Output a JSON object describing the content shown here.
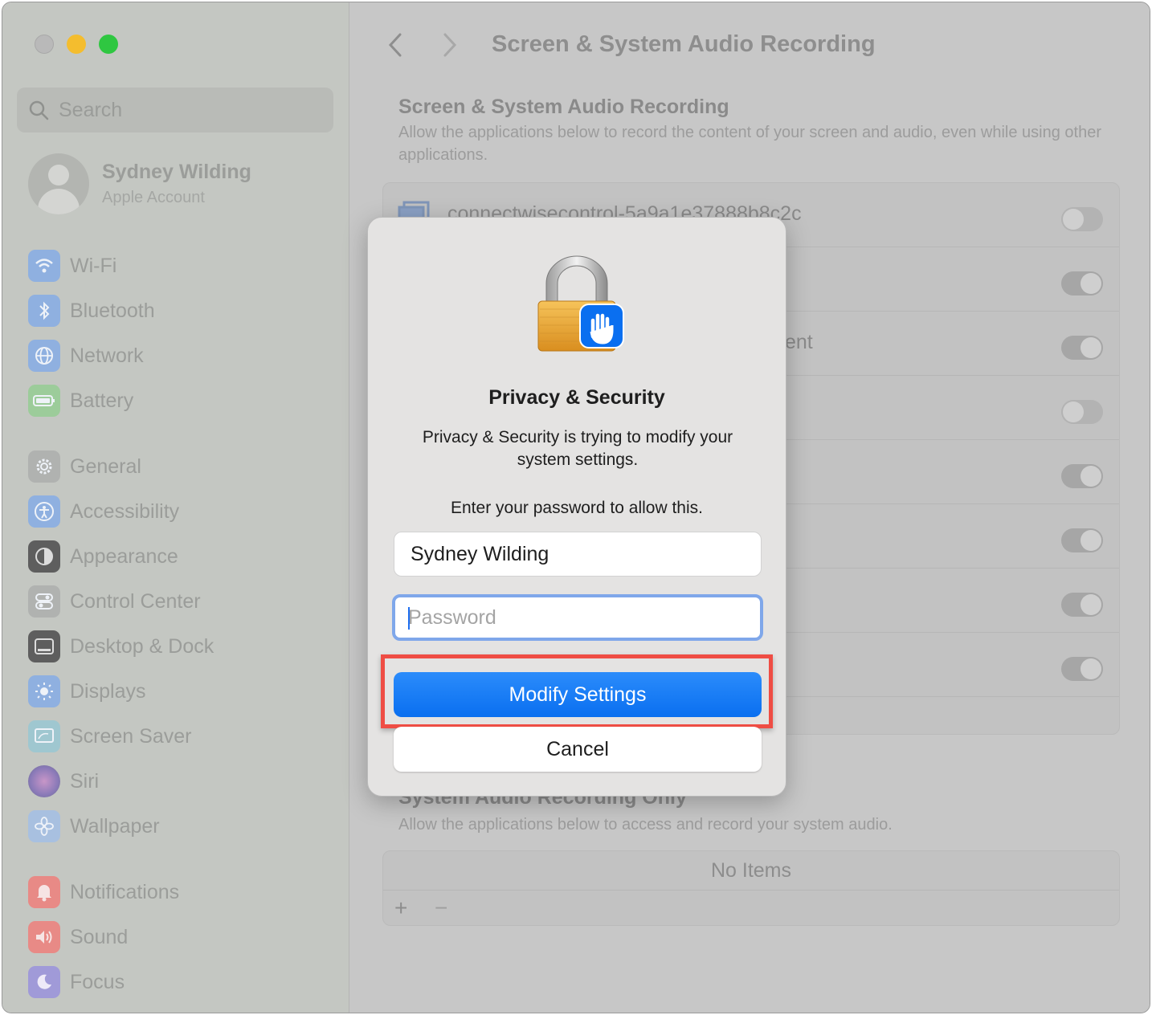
{
  "sidebar": {
    "search_placeholder": "Search",
    "account": {
      "name": "Sydney Wilding",
      "subtitle": "Apple Account"
    },
    "items": [
      {
        "label": "Wi-Fi",
        "icon": "wifi-icon",
        "color": "#8fb0e0"
      },
      {
        "label": "Bluetooth",
        "icon": "bluetooth-icon",
        "color": "#8fb0e0"
      },
      {
        "label": "Network",
        "icon": "globe-icon",
        "color": "#8fb0e0"
      },
      {
        "label": "Battery",
        "icon": "battery-icon",
        "color": "#9ccc9a"
      },
      {
        "label": "General",
        "icon": "gear-icon",
        "color": "#b0b2b0"
      },
      {
        "label": "Accessibility",
        "icon": "accessibility-icon",
        "color": "#8fb0e0"
      },
      {
        "label": "Appearance",
        "icon": "appearance-icon",
        "color": "#5e5e5e"
      },
      {
        "label": "Control Center",
        "icon": "control-center-icon",
        "color": "#b0b2b0"
      },
      {
        "label": "Desktop & Dock",
        "icon": "dock-icon",
        "color": "#5e5e5e"
      },
      {
        "label": "Displays",
        "icon": "sun-icon",
        "color": "#8fb0e0"
      },
      {
        "label": "Screen Saver",
        "icon": "screen-saver-icon",
        "color": "#9fc7d0"
      },
      {
        "label": "Siri",
        "icon": "siri-icon",
        "color": "#a888b8"
      },
      {
        "label": "Wallpaper",
        "icon": "flower-icon",
        "color": "#a8c0e0"
      },
      {
        "label": "Notifications",
        "icon": "bell-icon",
        "color": "#e88a86"
      },
      {
        "label": "Sound",
        "icon": "speaker-icon",
        "color": "#e88a86"
      },
      {
        "label": "Focus",
        "icon": "moon-icon",
        "color": "#a09ad8"
      }
    ]
  },
  "main": {
    "title": "Screen & System Audio Recording",
    "section1": {
      "heading": "Screen & System Audio Recording",
      "description": "Allow the applications below to record the content of your screen and audio, even while using other applications."
    },
    "apps": [
      {
        "label": "connectwisecontrol-5a9a1e37888b8c2c",
        "on": false
      },
      {
        "label": "",
        "on": true
      },
      {
        "label": "ent",
        "on": true
      },
      {
        "label": "",
        "on": false
      },
      {
        "label": "",
        "on": true
      },
      {
        "label": "",
        "on": true
      },
      {
        "label": "",
        "on": true
      },
      {
        "label": "",
        "on": true
      }
    ],
    "section2": {
      "heading": "System Audio Recording Only",
      "description": "Allow the applications below to access and record your system audio."
    },
    "no_items": "No Items",
    "add_label": "+",
    "remove_label": "−"
  },
  "dialog": {
    "title": "Privacy & Security",
    "message": "Privacy & Security is trying to modify your system settings.",
    "prompt": "Enter your password to allow this.",
    "username": "Sydney Wilding",
    "password_placeholder": "Password",
    "primary_button": "Modify Settings",
    "cancel_button": "Cancel",
    "highlight_color": "#ef4d44",
    "accent_color": "#0a6ff0"
  }
}
